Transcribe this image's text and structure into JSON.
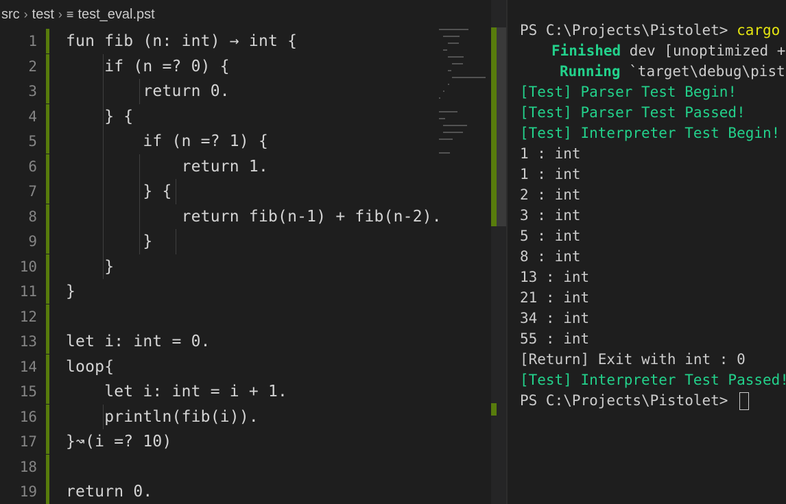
{
  "breadcrumb": {
    "segments": [
      "src",
      "test"
    ],
    "file": "test_eval.pst"
  },
  "editor": {
    "lines": [
      {
        "n": "1",
        "text": "fun fib (n: int) → int {"
      },
      {
        "n": "2",
        "text": "    if (n =? 0) {"
      },
      {
        "n": "3",
        "text": "        return 0."
      },
      {
        "n": "4",
        "text": "    } {"
      },
      {
        "n": "5",
        "text": "        if (n =? 1) {"
      },
      {
        "n": "6",
        "text": "            return 1."
      },
      {
        "n": "7",
        "text": "        } {"
      },
      {
        "n": "8",
        "text": "            return fib(n-1) + fib(n-2)."
      },
      {
        "n": "9",
        "text": "        }"
      },
      {
        "n": "10",
        "text": "    }"
      },
      {
        "n": "11",
        "text": "}"
      },
      {
        "n": "12",
        "text": ""
      },
      {
        "n": "13",
        "text": "let i: int = 0."
      },
      {
        "n": "14",
        "text": "loop{"
      },
      {
        "n": "15",
        "text": "    let i: int = i + 1."
      },
      {
        "n": "16",
        "text": "    println(fib(i))."
      },
      {
        "n": "17",
        "text": "}↝(i =? 10)"
      },
      {
        "n": "18",
        "text": ""
      },
      {
        "n": "19",
        "text": "return 0."
      }
    ]
  },
  "terminal": {
    "prompt": "PS C:\\Projects\\Pistolet> ",
    "command": "cargo run",
    "finished_label": "Finished",
    "finished_rest": " dev [unoptimized + debuginfo]",
    "running_label": "Running",
    "running_rest": " `target\\debug\\pistolet.exe`",
    "test_lines": [
      "[Test] Parser Test Begin!",
      "[Test] Parser Test Passed!",
      "[Test] Interpreter Test Begin!"
    ],
    "outputs": [
      "1 : int",
      "1 : int",
      "2 : int",
      "3 : int",
      "5 : int",
      "8 : int",
      "13 : int",
      "21 : int",
      "34 : int",
      "55 : int"
    ],
    "return_line": "[Return] Exit with int : 0",
    "passed_line": "[Test] Interpreter Test Passed!",
    "final_prompt": "PS C:\\Projects\\Pistolet> "
  },
  "colors": {
    "green": "#23d18b",
    "yellow": "#e5e510",
    "gutter_mark": "#587c0c"
  },
  "icons": {
    "file": "list-lines-icon",
    "chevron": "chevron-right-icon"
  }
}
